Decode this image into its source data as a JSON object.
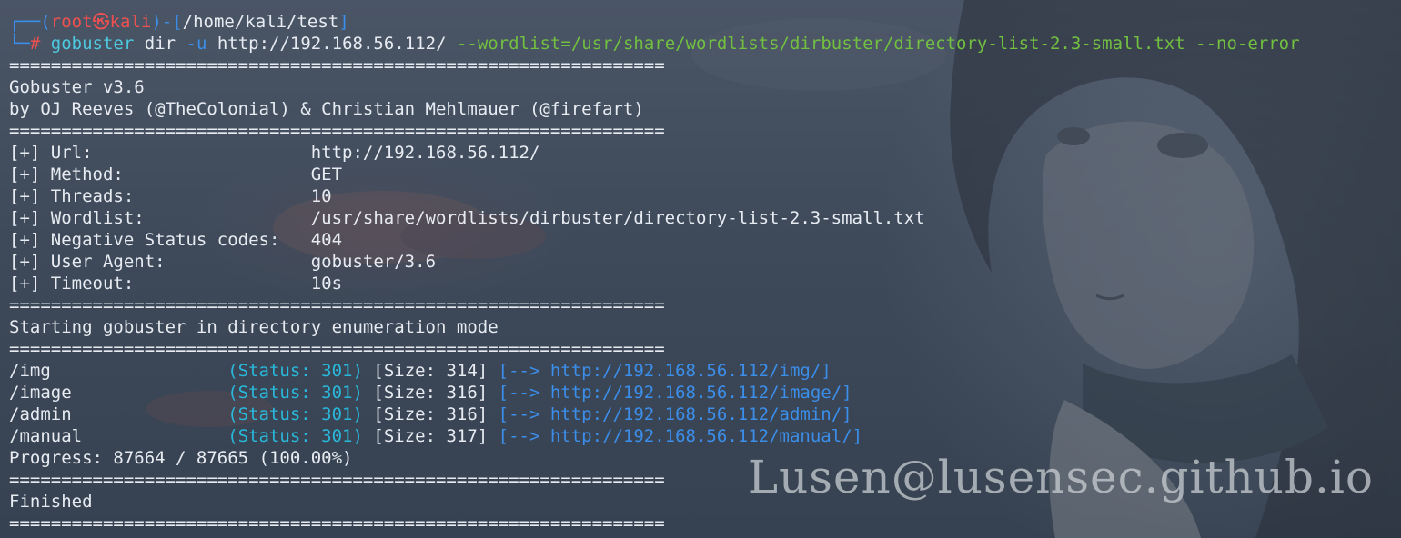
{
  "prompt": {
    "corner_top": "┌──",
    "user": "root",
    "at_symbol": "㉿",
    "host": "kali",
    "path_prefix": ")-[",
    "path": "/home/kali/test",
    "path_suffix": "]",
    "corner_bottom": "└─",
    "hash": "#",
    "open_paren": "("
  },
  "command": {
    "program": "gobuster",
    "subcommand": " dir ",
    "flag_u": "-u",
    "url": " http://192.168.56.112/ ",
    "wordlist_arg": "--wordlist=/usr/share/wordlists/dirbuster/directory-list-2.3-small.txt",
    "space": " ",
    "no_error": "--no-error"
  },
  "separator": "===============================================================",
  "banner": {
    "title": "Gobuster v3.6",
    "authors": "by OJ Reeves (@TheColonial) & Christian Mehlmauer (@firefart)"
  },
  "config": [
    {
      "label": "[+] Url:                     ",
      "value": "http://192.168.56.112/"
    },
    {
      "label": "[+] Method:                  ",
      "value": "GET"
    },
    {
      "label": "[+] Threads:                 ",
      "value": "10"
    },
    {
      "label": "[+] Wordlist:                ",
      "value": "/usr/share/wordlists/dirbuster/directory-list-2.3-small.txt"
    },
    {
      "label": "[+] Negative Status codes:   ",
      "value": "404"
    },
    {
      "label": "[+] User Agent:              ",
      "value": "gobuster/3.6"
    },
    {
      "label": "[+] Timeout:                 ",
      "value": "10s"
    }
  ],
  "mode_text": "Starting gobuster in directory enumeration mode",
  "results": [
    {
      "path": "/img                 ",
      "status": "(Status: 301)",
      "size": " [Size: 314] ",
      "redirect": "[--> http://192.168.56.112/img/]"
    },
    {
      "path": "/image               ",
      "status": "(Status: 301)",
      "size": " [Size: 316] ",
      "redirect": "[--> http://192.168.56.112/image/]"
    },
    {
      "path": "/admin               ",
      "status": "(Status: 301)",
      "size": " [Size: 316] ",
      "redirect": "[--> http://192.168.56.112/admin/]"
    },
    {
      "path": "/manual              ",
      "status": "(Status: 301)",
      "size": " [Size: 317] ",
      "redirect": "[--> http://192.168.56.112/manual/]"
    }
  ],
  "progress": "Progress: 87664 / 87665 (100.00%)",
  "finished": "Finished",
  "watermark": "Lusen@lusensec.github.io",
  "colors": {
    "background": "#3d4a5a",
    "text": "#e8ecf2",
    "prompt_blue": "#3b8eea",
    "prompt_red": "#f05050",
    "command_cyan": "#4ec9e0",
    "wordlist_green": "#72c040",
    "status_cyan": "#29b8db"
  }
}
